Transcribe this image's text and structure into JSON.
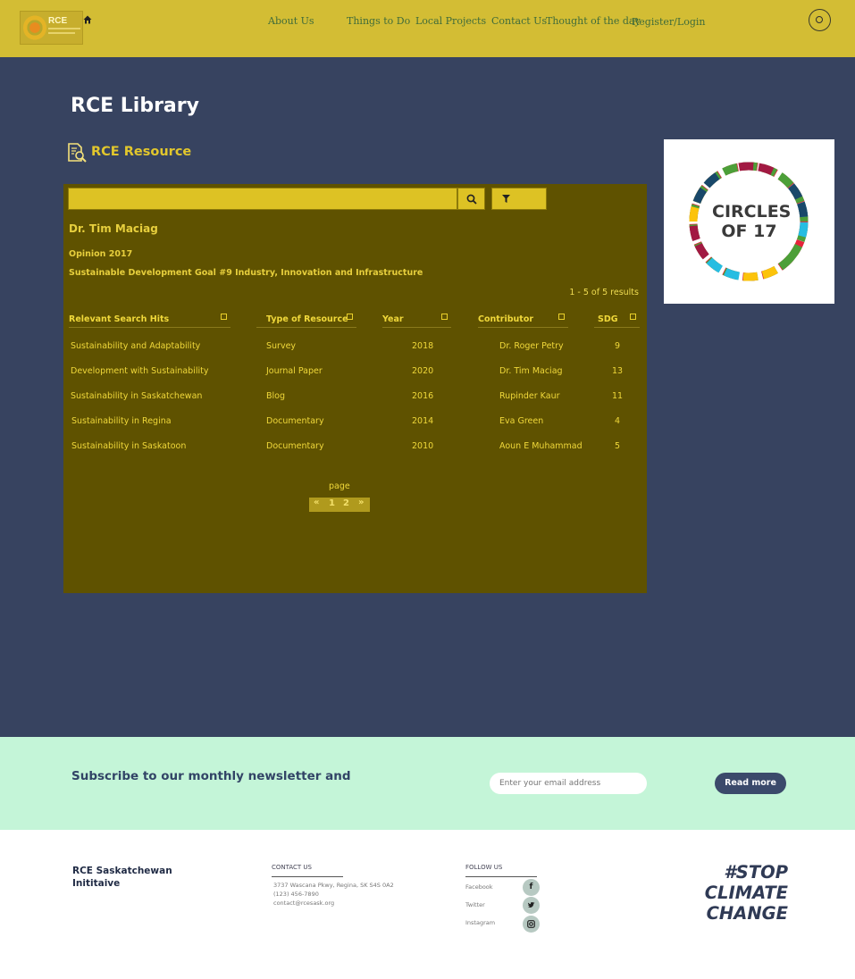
{
  "header": {
    "logo_text": "RCE",
    "nav": [
      "About Us",
      "Things to Do",
      "Local Projects",
      "Contact Us",
      "Thought of the day",
      "Register/Login"
    ]
  },
  "page": {
    "title": "RCE Library",
    "section_title": "RCE Resource"
  },
  "detail": {
    "contributor": "Dr. Tim Maciag",
    "opinion": "Opinion 2017",
    "sdg": "Sustainable Development Goal #9 Industry, Innovation and Infrastructure",
    "results": "1 - 5 of 5 results"
  },
  "table": {
    "headers": [
      "Relevant Search Hits",
      "Type of Resource",
      "Year",
      "Contributor",
      "SDG"
    ],
    "rows": [
      [
        "Sustainability and Adaptability",
        "Survey",
        "2018",
        "Dr. Roger Petry",
        "9"
      ],
      [
        "Development with Sustainability",
        "Journal Paper",
        "2020",
        "Dr. Tim Maciag",
        "13"
      ],
      [
        "Sustainability in Saskatchewan",
        "Blog",
        "2016",
        "Rupinder Kaur",
        "11"
      ],
      [
        "Sustainability in Regina",
        "Documentary",
        "2014",
        "Eva Green",
        "4"
      ],
      [
        "Sustainability in Saskatoon",
        "Documentary",
        "2010",
        "Aoun E Muhammad",
        "5"
      ]
    ]
  },
  "pagination": {
    "label": "page",
    "prev": "«",
    "pages": [
      "1",
      "2"
    ],
    "next": "»"
  },
  "sidebar": {
    "image_line1": "CIRCLES",
    "image_line2": "OF 17"
  },
  "newsletter": {
    "text": "Subscribe to our monthly newsletter and",
    "email_placeholder": "Enter your email address",
    "button": "Read more"
  },
  "footer": {
    "org_line1": "RCE Saskatchewan",
    "org_line2": "Inititaive",
    "contact_heading": "CONTACT US",
    "address": "3737 Wascana Pkwy, Regina, SK S4S 0A2",
    "phone": "(123) 456-7890",
    "email": "contact@rcesask.org",
    "follow_heading": "FOLLOW US",
    "social": [
      "Facebook",
      "Twitter",
      "Instagram"
    ],
    "slogan": [
      "#STOP",
      "CLIMATE",
      "CHANGE"
    ]
  },
  "colors": {
    "header_bg": "#d3bd34",
    "page_bg": "#374360",
    "panel_bg": "#5f5200",
    "accent_yellow": "#e2c72c",
    "newsletter_bg": "#c4f5d8"
  },
  "icons": [
    "home-icon",
    "search-icon",
    "resource-icon",
    "magnifier-icon",
    "filter-icon",
    "sort-icon",
    "facebook-icon",
    "twitter-icon",
    "instagram-icon"
  ]
}
